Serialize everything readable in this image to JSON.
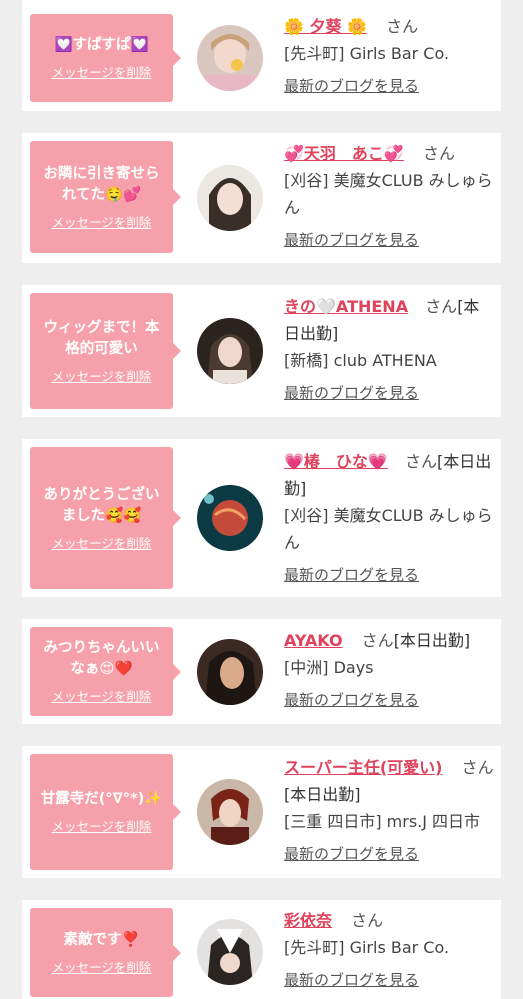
{
  "cards": [
    {
      "message": "💟すぱすぱ💟",
      "delete_label": "メッセージを削除",
      "name": "🌼 夕葵 🌼",
      "honorific": "さん",
      "status": "",
      "shop": "[先斗町] Girls Bar Co.",
      "blog_label": "最新のブログを見る"
    },
    {
      "message": "お隣に引き寄せられてた🤤💕",
      "delete_label": "メッセージを削除",
      "name": "💞天羽　あこ💞",
      "honorific": "さん",
      "status": "",
      "shop": "[刈谷] 美魔女CLUB みしゅらん",
      "blog_label": "最新のブログを見る"
    },
    {
      "message": "ウィッグまで！本格的可愛い",
      "delete_label": "メッセージを削除",
      "name": "きの🤍ATHENA",
      "honorific": "さん",
      "status": "[本日出勤]",
      "shop": "[新橋] club ATHENA",
      "blog_label": "最新のブログを見る"
    },
    {
      "message": "ありがとうございました🥰🥰",
      "delete_label": "メッセージを削除",
      "name": "💗椿　ひな💗",
      "honorific": "さん",
      "status": "[本日出勤]",
      "shop": "[刈谷] 美魔女CLUB みしゅらん",
      "blog_label": "最新のブログを見る"
    },
    {
      "message": "みつりちゃんいいなぁ😍❤️",
      "delete_label": "メッセージを削除",
      "name": "AYAKO",
      "honorific": "さん",
      "status": "[本日出勤]",
      "shop": "[中洲] Days",
      "blog_label": "最新のブログを見る"
    },
    {
      "message": "甘露寺だ(°∇°*)✨",
      "delete_label": "メッセージを削除",
      "name": "スーパー主任(可愛い)",
      "honorific": "さん",
      "status": "[本日出勤]",
      "shop": "[三重 四日市] mrs.J 四日市",
      "blog_label": "最新のブログを見る"
    },
    {
      "message": "素敵です❣️",
      "delete_label": "メッセージを削除",
      "name": "彩依奈",
      "honorific": "さん",
      "status": "",
      "shop": "[先斗町] Girls Bar Co.",
      "blog_label": "最新のブログを見る"
    }
  ],
  "colors": {
    "bubble": "#f6a0ab",
    "name": "#e0415b",
    "background": "#eeeeee"
  }
}
